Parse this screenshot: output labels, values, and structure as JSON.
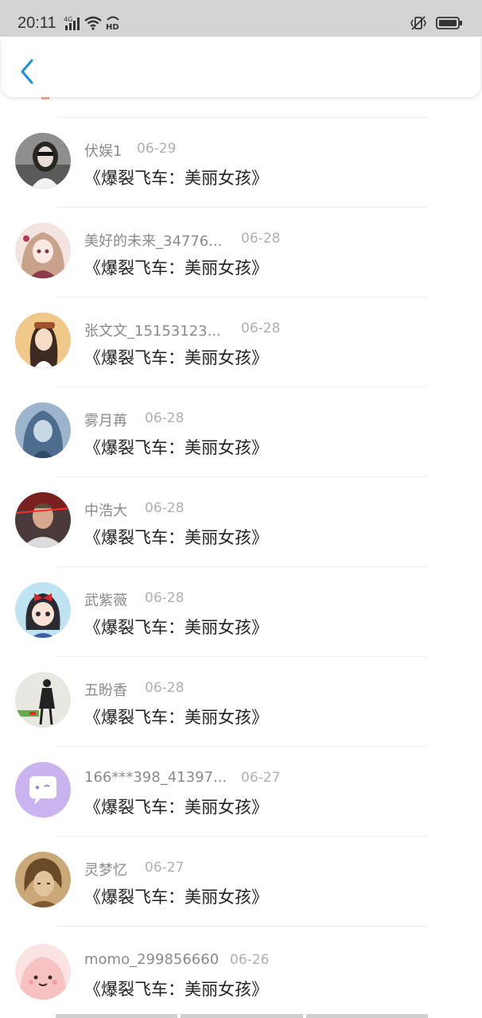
{
  "status_bar": {
    "time": "20:11",
    "network": "4G",
    "hd": "HD",
    "icons": [
      "signal-icon",
      "wifi-icon",
      "hd-icon",
      "vibrate-icon",
      "battery-icon"
    ]
  },
  "header": {
    "back_icon": "chevron-left-icon",
    "accent": "#1a8fe0"
  },
  "items": [
    {
      "name": "伏娱1",
      "date": "06-29",
      "title": "《爆裂飞车：美丽女孩》",
      "avatar": "photo-girl-avatar"
    },
    {
      "name": "美好的未来_34776...",
      "date": "06-28",
      "title": "《爆裂飞车：美丽女孩》",
      "avatar": "anime-girl-avatar"
    },
    {
      "name": "张文文_15153123...",
      "date": "06-28",
      "title": "《爆裂飞车：美丽女孩》",
      "avatar": "illustrated-girl-avatar"
    },
    {
      "name": "雾月苒",
      "date": "06-28",
      "title": "《爆裂飞车：美丽女孩》",
      "avatar": "blue-anime-avatar"
    },
    {
      "name": "中浩大",
      "date": "06-28",
      "title": "《爆裂飞车：美丽女孩》",
      "avatar": "man-photo-avatar"
    },
    {
      "name": "武紫薇",
      "date": "06-28",
      "title": "《爆裂飞车：美丽女孩》",
      "avatar": "cartoon-girl-avatar"
    },
    {
      "name": "五盼香",
      "date": "06-28",
      "title": "《爆裂飞车：美丽女孩》",
      "avatar": "figure-sketch-avatar"
    },
    {
      "name": "166***398_41397...",
      "date": "06-27",
      "title": "《爆裂飞车：美丽女孩》",
      "avatar": "chat-bubble-avatar"
    },
    {
      "name": "灵梦忆",
      "date": "06-27",
      "title": "《爆裂飞车：美丽女孩》",
      "avatar": "sketch-portrait-avatar"
    },
    {
      "name": "momo_299856660",
      "date": "06-26",
      "title": "《爆裂飞车：美丽女孩》",
      "avatar": "pink-blob-avatar"
    }
  ]
}
